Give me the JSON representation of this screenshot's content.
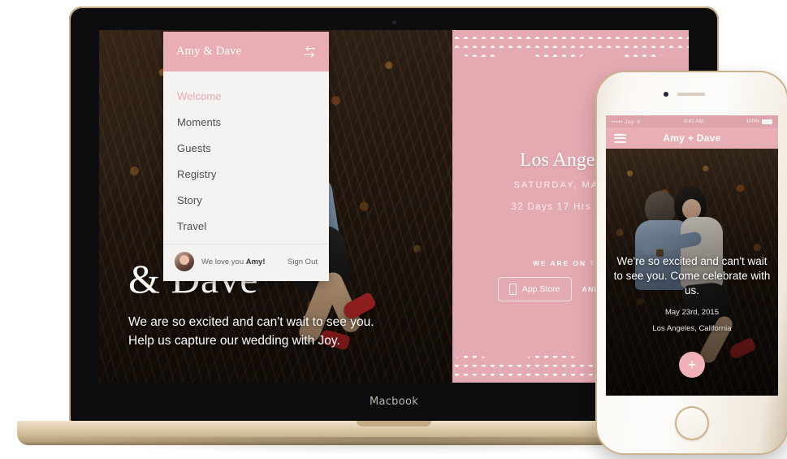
{
  "device_labels": {
    "macbook": "Macbook"
  },
  "sidebar": {
    "brand": "Amy & Dave",
    "toggle_icon": "toggle-arrows-icon",
    "items": [
      {
        "label": "Welcome"
      },
      {
        "label": "Moments"
      },
      {
        "label": "Guests"
      },
      {
        "label": "Registry"
      },
      {
        "label": "Story"
      },
      {
        "label": "Travel"
      }
    ],
    "footer": {
      "greeting_prefix": "We love you ",
      "user_name": "Amy!",
      "sign_out": "Sign Out",
      "avatar_icon": "user-avatar"
    }
  },
  "hero": {
    "title": "& Dave",
    "line1": "We are so excited and can't wait to see you.",
    "line2": "Help us capture our wedding with Joy."
  },
  "invite": {
    "city": "Los Angeles,",
    "date": "SATURDAY, MAY 23,",
    "countdown": "32 Days   17 Hrs   35 Min",
    "on_the_prefix": "WE ARE ON ",
    "on_the_suffix": "THE",
    "app_store_label": "App Store",
    "app_store_icon": "phone-icon",
    "and_label": "AND",
    "play_store_icon": "google-play-icon"
  },
  "phone": {
    "status": {
      "carrier": "••••• Joy ᯤ",
      "time": "9:41 AM",
      "battery": "100%"
    },
    "nav": {
      "title": "Amy + Dave",
      "menu_icon": "hamburger-menu-icon"
    },
    "content": {
      "headline": "We're so excited and can't wait to see you. Come celebrate with us.",
      "date": "May 23rd, 2015",
      "location": "Los Angeles, California",
      "fab_label": "+",
      "fab_icon": "add-icon"
    }
  },
  "colors": {
    "brand_pink": "#e9aeb4",
    "sidebar_bg": "#f4f3f1",
    "active_link": "#eaa7ae",
    "fab_pink": "#efb1b7"
  }
}
